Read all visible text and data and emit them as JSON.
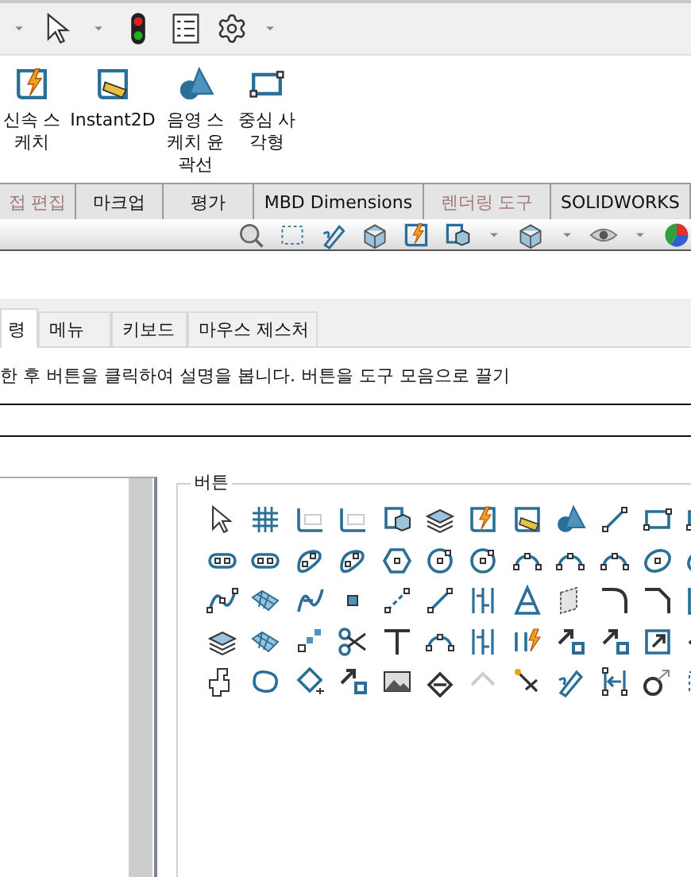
{
  "ribbon": {
    "buttons": [
      {
        "label": "신속 스\n케치"
      },
      {
        "label": "Instant2D"
      },
      {
        "label": "음영 스\n케치 윤\n곽선"
      },
      {
        "label": "중심 사\n각형"
      }
    ]
  },
  "command_tabs": [
    {
      "label": "접 편집",
      "disabled": true
    },
    {
      "label": "마크업",
      "disabled": false
    },
    {
      "label": "평가",
      "disabled": false
    },
    {
      "label": "MBD Dimensions",
      "disabled": false
    },
    {
      "label": "렌더링 도구",
      "disabled": true
    },
    {
      "label": "SOLIDWORKS",
      "disabled": false
    }
  ],
  "dialog": {
    "tabs": [
      {
        "label": "령",
        "selected": true
      },
      {
        "label": "메뉴",
        "selected": false
      },
      {
        "label": "키보드",
        "selected": false
      },
      {
        "label": "마우스 제스처",
        "selected": false
      }
    ],
    "instruction": "한 후 버튼을 클릭하여 설명을 봅니다. 버튼을 도구 모음으로 끌기",
    "buttons_group": {
      "label": "버튼"
    }
  }
}
